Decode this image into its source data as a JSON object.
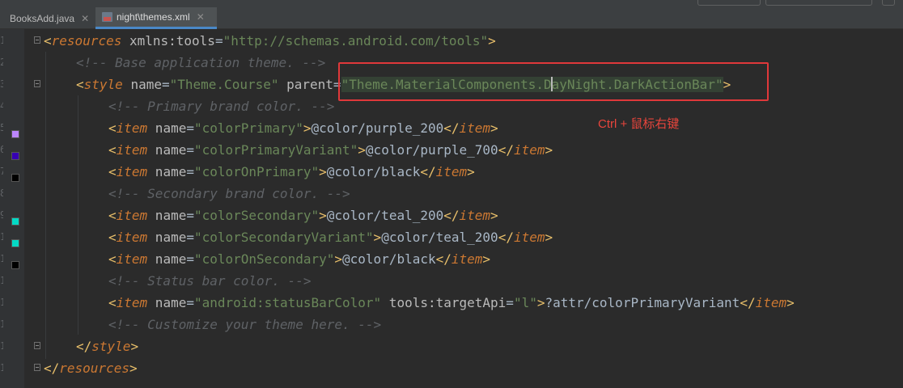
{
  "tabs": [
    {
      "label": "BooksAdd.java",
      "icon": "java-file-icon",
      "active": false
    },
    {
      "label": "night\\themes.xml",
      "icon": "xml-file-icon",
      "active": true
    }
  ],
  "colors": {
    "background": "#2b2b2b",
    "tag": "#e8bf6a",
    "keyword": "#cc7832",
    "string": "#6a8759",
    "comment": "#5f6266",
    "annotation_box": "#e0383a",
    "annotation_text": "#e8453c"
  },
  "gutter_swatches": [
    {
      "line": 5,
      "color": "#bb86fc"
    },
    {
      "line": 6,
      "color": "#3700b3"
    },
    {
      "line": 7,
      "color": "#000000"
    },
    {
      "line": 9,
      "color": "#03dac5"
    },
    {
      "line": 10,
      "color": "#03dac5"
    },
    {
      "line": 11,
      "color": "#000000"
    }
  ],
  "code": {
    "l1": {
      "open": "<",
      "tag": "resources",
      "attr": " xmlns:tools",
      "eq": "=",
      "val": "\"http://schemas.android.com/tools\"",
      "close": ">"
    },
    "l2": {
      "comment": "<!-- Base application theme. -->"
    },
    "l3": {
      "open": "<",
      "tag": "style",
      "a1": " name",
      "eq1": "=",
      "v1": "\"Theme.Course\"",
      "a2": " parent",
      "eq2": "=",
      "v2q": "\"",
      "v2a": "Theme.MaterialComponents.D",
      "v2b": "ayNight.DarkActionBar",
      "v2q2": "\"",
      "close": ">"
    },
    "l4": {
      "comment": "<!-- Primary brand color. -->"
    },
    "l5": {
      "open": "<",
      "tag": "item",
      "attr": " name",
      "eq": "=",
      "val": "\"colorPrimary\"",
      "close": ">",
      "body": "@color/purple_200",
      "end_open": "</",
      "end_tag": "item",
      "end_close": ">"
    },
    "l6": {
      "open": "<",
      "tag": "item",
      "attr": " name",
      "eq": "=",
      "val": "\"colorPrimaryVariant\"",
      "close": ">",
      "body": "@color/purple_700",
      "end_open": "</",
      "end_tag": "item",
      "end_close": ">"
    },
    "l7": {
      "open": "<",
      "tag": "item",
      "attr": " name",
      "eq": "=",
      "val": "\"colorOnPrimary\"",
      "close": ">",
      "body": "@color/black",
      "end_open": "</",
      "end_tag": "item",
      "end_close": ">"
    },
    "l8": {
      "comment": "<!-- Secondary brand color. -->"
    },
    "l9": {
      "open": "<",
      "tag": "item",
      "attr": " name",
      "eq": "=",
      "val": "\"colorSecondary\"",
      "close": ">",
      "body": "@color/teal_200",
      "end_open": "</",
      "end_tag": "item",
      "end_close": ">"
    },
    "l10": {
      "open": "<",
      "tag": "item",
      "attr": " name",
      "eq": "=",
      "val": "\"colorSecondaryVariant\"",
      "close": ">",
      "body": "@color/teal_200",
      "end_open": "</",
      "end_tag": "item",
      "end_close": ">"
    },
    "l11": {
      "open": "<",
      "tag": "item",
      "attr": " name",
      "eq": "=",
      "val": "\"colorOnSecondary\"",
      "close": ">",
      "body": "@color/black",
      "end_open": "</",
      "end_tag": "item",
      "end_close": ">"
    },
    "l12": {
      "comment": "<!-- Status bar color. -->"
    },
    "l13": {
      "open": "<",
      "tag": "item",
      "a1": " name",
      "eq1": "=",
      "v1": "\"android:statusBarColor\"",
      "a2": " tools:targetApi",
      "eq2": "=",
      "v2": "\"l\"",
      "close": ">",
      "body": "?attr/colorPrimaryVariant",
      "end_open": "</",
      "end_tag": "item",
      "end_close": ">"
    },
    "l14": {
      "comment": "<!-- Customize your theme here. -->"
    },
    "l15": {
      "open": "</",
      "tag": "style",
      "close": ">"
    },
    "l16": {
      "open": "</",
      "tag": "resources",
      "close": ">"
    }
  },
  "annotation": {
    "text": "Ctrl + 鼠标右键"
  }
}
